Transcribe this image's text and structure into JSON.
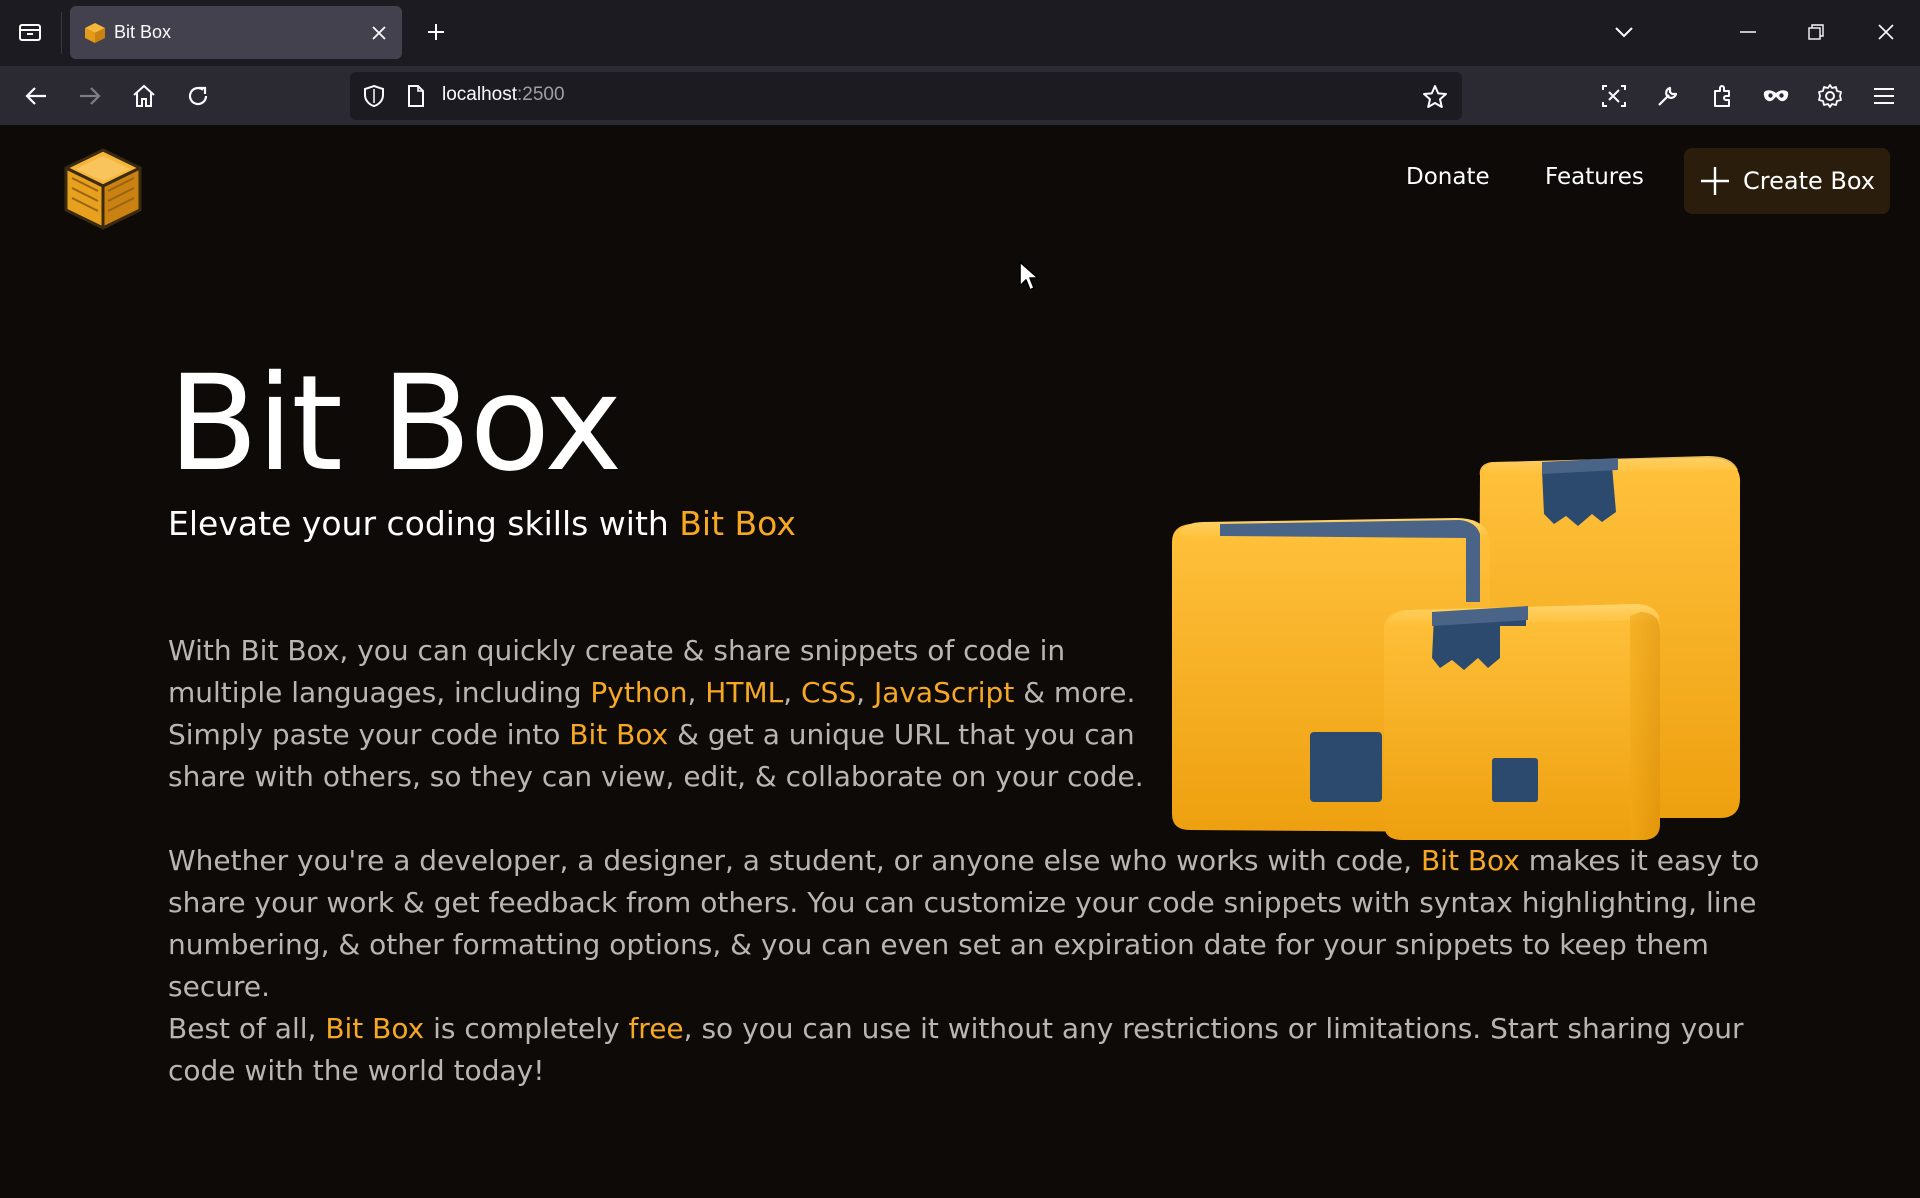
{
  "browser": {
    "tab": {
      "title": "Bit Box"
    },
    "url": {
      "host": "localhost",
      "port": ":2500"
    }
  },
  "site": {
    "nav": {
      "donate": "Donate",
      "features": "Features",
      "create_box": "Create Box"
    },
    "hero": {
      "title": "Bit Box",
      "subtitle_prefix": "Elevate your coding skills with ",
      "subtitle_accent": "Bit Box"
    },
    "para1": {
      "p1": "With Bit Box, you can quickly create & share snippets of code in multiple languages, including ",
      "lang1": "Python",
      "sep1": ", ",
      "lang2": "HTML",
      "sep2": ", ",
      "lang3": "CSS",
      "sep3": ", ",
      "lang4": "JavaScript",
      "p2": " & more. Simply paste your code into ",
      "brand": "Bit Box",
      "p3": " & get a unique URL that you can share with others, so they can view, edit, & collaborate on your code."
    },
    "para2": {
      "p1": "Whether you're a developer, a designer, a student, or anyone else who works with code, ",
      "brand": "Bit Box",
      "p2": " makes it easy to share your work & get feedback from others. You can customize your code snippets with syntax highlighting, line numbering, & other formatting options, & you can even set an expiration date for your snippets to keep them secure."
    },
    "para3": {
      "p1": "Best of all, ",
      "brand": "Bit Box",
      "p2": " is completely ",
      "free": "free",
      "p3": ", so you can use it without any restrictions or limitations. Start sharing your code with the world today!"
    }
  },
  "colors": {
    "accent": "#f7a823",
    "background": "#0e0a07",
    "button_bg": "#2a1d0b",
    "body_text": "#b9b6b2"
  },
  "icons": {
    "tabbar": [
      "tab-list-icon",
      "close-icon",
      "plus-icon",
      "chevron-down-icon",
      "minimize-icon",
      "restore-icon",
      "window-close-icon"
    ],
    "toolbar": [
      "back-arrow-icon",
      "forward-arrow-icon",
      "home-icon",
      "reload-icon",
      "shield-icon",
      "page-icon",
      "star-icon",
      "screenshot-icon",
      "wrench-icon",
      "extensions-icon",
      "private-mask-icon",
      "gear-icon",
      "hamburger-menu-icon"
    ]
  }
}
